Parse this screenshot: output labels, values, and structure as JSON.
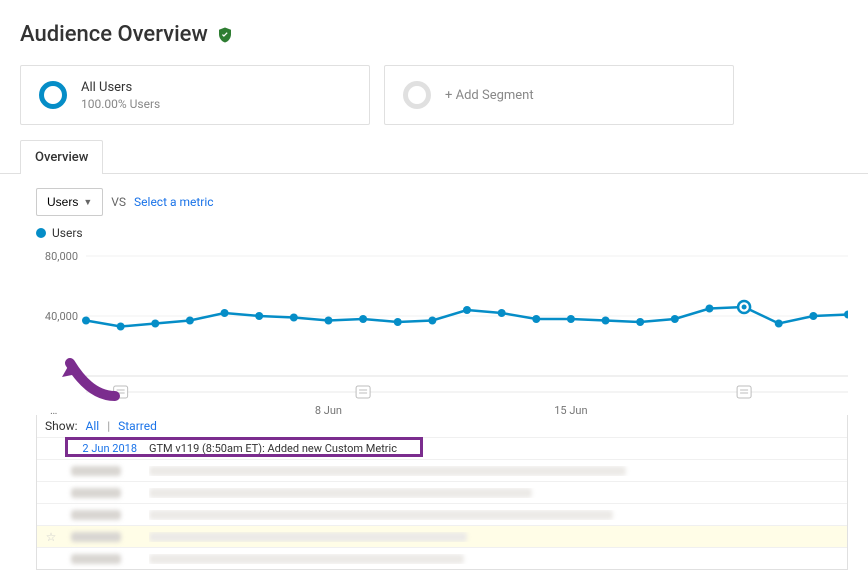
{
  "page": {
    "title": "Audience Overview"
  },
  "segments": {
    "primary": {
      "title": "All Users",
      "subtitle": "100.00% Users"
    },
    "add_label": "+ Add Segment"
  },
  "tabs": {
    "overview": "Overview"
  },
  "controls": {
    "metric_dropdown": "Users",
    "vs": "VS",
    "select_metric": "Select a metric"
  },
  "chart_data": {
    "type": "line",
    "series_name": "Users",
    "y_ticks": [
      "40,000",
      "80,000"
    ],
    "x_ticks": [
      "…",
      "8 Jun",
      "15 Jun"
    ],
    "ylim": [
      0,
      80000
    ],
    "points": [
      37000,
      33000,
      35000,
      37000,
      42000,
      40000,
      39000,
      37000,
      38000,
      36000,
      37000,
      44000,
      42000,
      38000,
      38000,
      37000,
      36000,
      38000,
      45000,
      46000,
      35000,
      40000,
      41000
    ],
    "highlighted_index": 19,
    "annotation_marker_indices": [
      1,
      8,
      19
    ]
  },
  "annotations": {
    "show_label": "Show:",
    "filter_all": "All",
    "filter_starred": "Starred",
    "rows": [
      {
        "date": "2 Jun 2018",
        "text": "GTM v119 (8:50am ET): Added new Custom Metric",
        "highlighted": true,
        "starred": false
      },
      {
        "blurred": true
      },
      {
        "blurred": true
      },
      {
        "blurred": true
      },
      {
        "blurred": true,
        "starred": true
      },
      {
        "blurred": true
      }
    ]
  }
}
